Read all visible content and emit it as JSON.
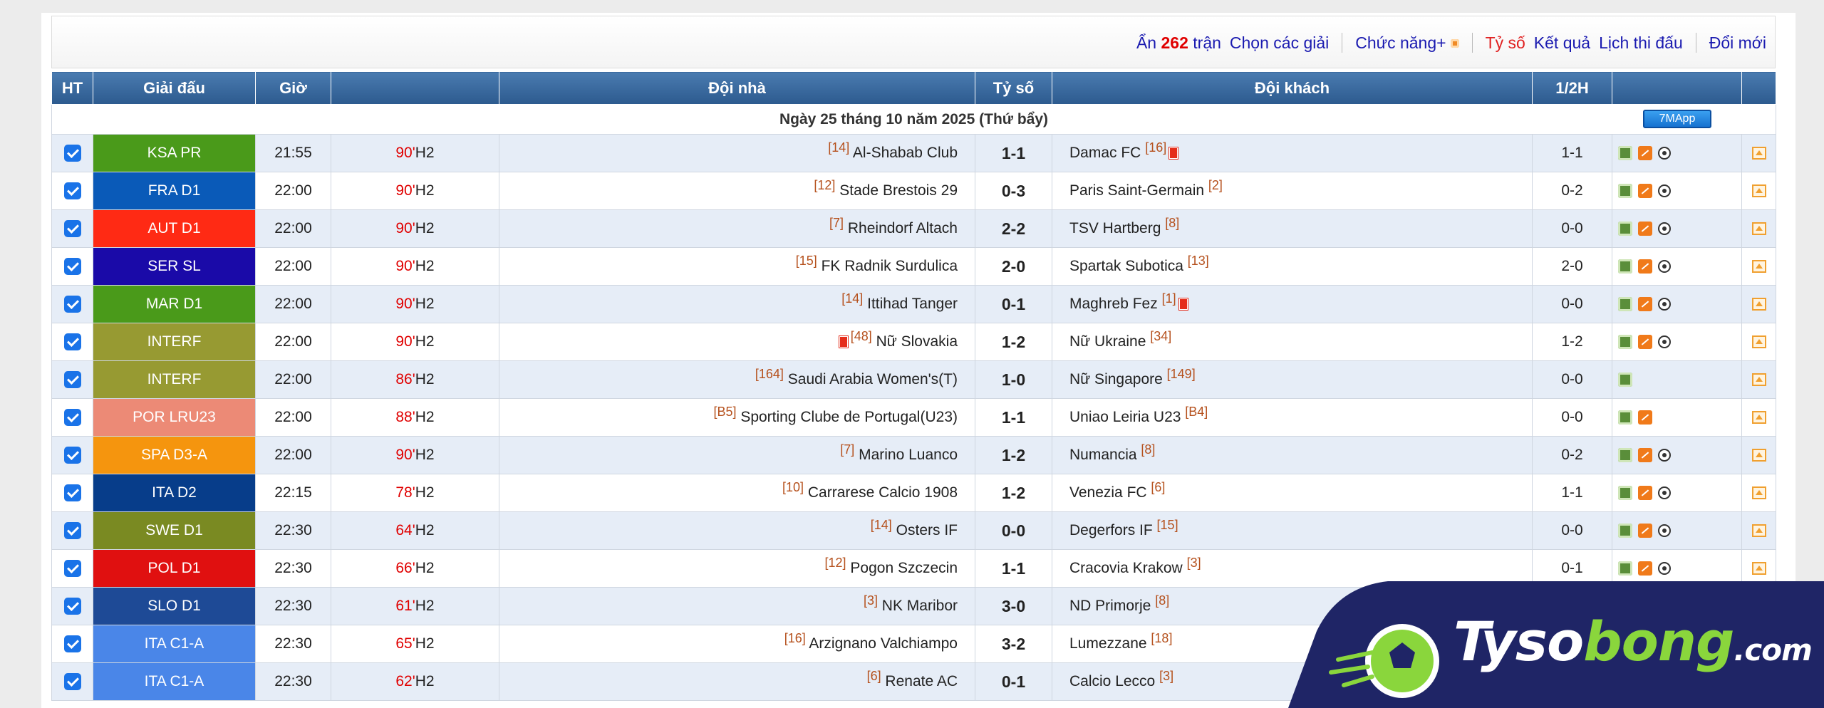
{
  "toolbar": {
    "hide_prefix": "Ẩn",
    "hide_count": "262",
    "hide_suffix": "trận",
    "choose_leagues": "Chọn các giải",
    "functions": "Chức năng+",
    "score": "Tỷ số",
    "results": "Kết quả",
    "schedule": "Lịch thi đấu",
    "refresh": "Đổi mới"
  },
  "table": {
    "headers": [
      "HT",
      "Giải đấu",
      "Giờ",
      "",
      "Đội nhà",
      "Tỷ số",
      "Đội khách",
      "1/2H",
      "",
      ""
    ],
    "date_label": "Ngày 25 tháng 10 năm 2025 (Thứ bẩy)",
    "app_button": "7MApp",
    "rows": [
      {
        "league": "KSA PR",
        "color": "#4a9a1a",
        "time": "21:55",
        "minute": "90'",
        "period": "H2",
        "home_rank": "[14]",
        "home": "Al-Shabab Club",
        "score": "1-1",
        "away": "Damac FC",
        "away_rank": "[16]",
        "half": "1-1"
      },
      {
        "league": "FRA D1",
        "color": "#0a5ab8",
        "time": "22:00",
        "minute": "90'",
        "period": "H2",
        "home_rank": "[12]",
        "home": "Stade Brestois 29",
        "score": "0-3",
        "away": "Paris Saint-Germain",
        "away_rank": "[2]",
        "half": "0-2"
      },
      {
        "league": "AUT D1",
        "color": "#ff2a14",
        "time": "22:00",
        "minute": "90'",
        "period": "H2",
        "home_rank": "[7]",
        "home": "Rheindorf Altach",
        "score": "2-2",
        "away": "TSV Hartberg",
        "away_rank": "[8]",
        "half": "0-0"
      },
      {
        "league": "SER SL",
        "color": "#1a0aa8",
        "time": "22:00",
        "minute": "90'",
        "period": "H2",
        "home_rank": "[15]",
        "home": "FK Radnik Surdulica",
        "score": "2-0",
        "away": "Spartak Subotica",
        "away_rank": "[13]",
        "half": "2-0"
      },
      {
        "league": "MAR D1",
        "color": "#4a9a1a",
        "time": "22:00",
        "minute": "90'",
        "period": "H2",
        "home_rank": "[14]",
        "home": "Ittihad Tanger",
        "score": "0-1",
        "away": "Maghreb Fez",
        "away_rank": "[1]",
        "half": "0-0"
      },
      {
        "league": "INTERF",
        "color": "#979a32",
        "time": "22:00",
        "minute": "90'",
        "period": "H2",
        "home_rank": "[48]",
        "home": "Nữ Slovakia",
        "score": "1-2",
        "away": "Nữ Ukraine",
        "away_rank": "[34]",
        "half": "1-2"
      },
      {
        "league": "INTERF",
        "color": "#979a32",
        "time": "22:00",
        "minute": "86'",
        "period": "H2",
        "home_rank": "[164]",
        "home": "Saudi Arabia Women's(T)",
        "score": "1-0",
        "away": "Nữ Singapore",
        "away_rank": "[149]",
        "half": "0-0"
      },
      {
        "league": "POR LRU23",
        "color": "#ec8a76",
        "time": "22:00",
        "minute": "88'",
        "period": "H2",
        "home_rank": "[B5]",
        "home": "Sporting Clube de Portugal(U23)",
        "score": "1-1",
        "away": "Uniao Leiria U23",
        "away_rank": "[B4]",
        "half": "0-0"
      },
      {
        "league": "SPA D3-A",
        "color": "#f5950e",
        "time": "22:00",
        "minute": "90'",
        "period": "H2",
        "home_rank": "[7]",
        "home": "Marino Luanco",
        "score": "1-2",
        "away": "Numancia",
        "away_rank": "[8]",
        "half": "0-2"
      },
      {
        "league": "ITA D2",
        "color": "#073d8a",
        "time": "22:15",
        "minute": "78'",
        "period": "H2",
        "home_rank": "[10]",
        "home": "Carrarese Calcio 1908",
        "score": "1-2",
        "away": "Venezia FC",
        "away_rank": "[6]",
        "half": "1-1"
      },
      {
        "league": "SWE D1",
        "color": "#7a8a22",
        "time": "22:30",
        "minute": "64'",
        "period": "H2",
        "home_rank": "[14]",
        "home": "Osters IF",
        "score": "0-0",
        "away": "Degerfors IF",
        "away_rank": "[15]",
        "half": "0-0"
      },
      {
        "league": "POL D1",
        "color": "#e01010",
        "time": "22:30",
        "minute": "66'",
        "period": "H2",
        "home_rank": "[12]",
        "home": "Pogon Szczecin",
        "score": "1-1",
        "away": "Cracovia Krakow",
        "away_rank": "[3]",
        "half": "0-1"
      },
      {
        "league": "SLO D1",
        "color": "#1e4a96",
        "time": "22:30",
        "minute": "61'",
        "period": "H2",
        "home_rank": "[3]",
        "home": "NK Maribor",
        "score": "3-0",
        "away": "ND Primorje",
        "away_rank": "[8]",
        "half": ""
      },
      {
        "league": "ITA C1-A",
        "color": "#4a86e8",
        "time": "22:30",
        "minute": "65'",
        "period": "H2",
        "home_rank": "[16]",
        "home": "Arzignano Valchiampo",
        "score": "3-2",
        "away": "Lumezzane",
        "away_rank": "[18]",
        "half": ""
      },
      {
        "league": "ITA C1-A",
        "color": "#4a86e8",
        "time": "22:30",
        "minute": "62'",
        "period": "H2",
        "home_rank": "[6]",
        "home": "Renate AC",
        "score": "0-1",
        "away": "Calcio Lecco",
        "away_rank": "[3]",
        "half": ""
      }
    ]
  },
  "logo": {
    "part1": "Tyso",
    "part2": "bong",
    "part3": ".com"
  }
}
